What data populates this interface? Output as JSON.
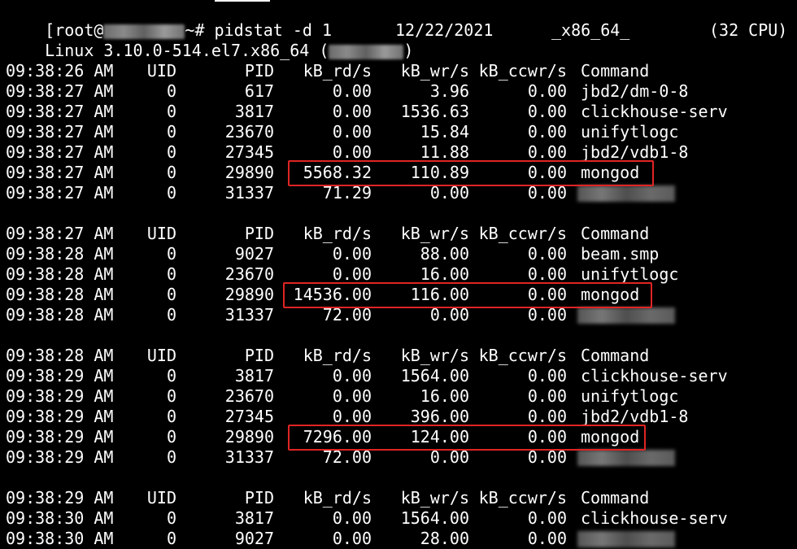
{
  "prompt": {
    "open": "[root@",
    "tail": "~# pidstat -d 1"
  },
  "sysline": {
    "kernel": "Linux 3.10.0-514.el7.x86_64 (",
    "host_close": ")",
    "date": "12/22/2021",
    "arch": "_x86_64_",
    "cpus": "(32 CPU)"
  },
  "columns": {
    "uid": "UID",
    "pid": "PID",
    "rd": "kB_rd/s",
    "wr": "kB_wr/s",
    "ccwr": "kB_ccwr/s",
    "cmd": "Command"
  },
  "blocks": [
    {
      "header_time": "09:38:26 AM",
      "rows": [
        {
          "time": "09:38:27 AM",
          "uid": "0",
          "pid": "617",
          "rd": "0.00",
          "wr": "3.96",
          "ccwr": "0.00",
          "cmd": "jbd2/dm-0-8"
        },
        {
          "time": "09:38:27 AM",
          "uid": "0",
          "pid": "3817",
          "rd": "0.00",
          "wr": "1536.63",
          "ccwr": "0.00",
          "cmd": "clickhouse-serv"
        },
        {
          "time": "09:38:27 AM",
          "uid": "0",
          "pid": "23670",
          "rd": "0.00",
          "wr": "15.84",
          "ccwr": "0.00",
          "cmd": "unifytlogc"
        },
        {
          "time": "09:38:27 AM",
          "uid": "0",
          "pid": "27345",
          "rd": "0.00",
          "wr": "11.88",
          "ccwr": "0.00",
          "cmd": "jbd2/vdb1-8"
        },
        {
          "time": "09:38:27 AM",
          "uid": "0",
          "pid": "29890",
          "rd": "5568.32",
          "wr": "110.89",
          "ccwr": "0.00",
          "cmd": "mongod"
        },
        {
          "time": "09:38:27 AM",
          "uid": "0",
          "pid": "31337",
          "rd": "71.29",
          "wr": "0.00",
          "ccwr": "0.00",
          "cmd": ""
        }
      ]
    },
    {
      "header_time": "09:38:27 AM",
      "rows": [
        {
          "time": "09:38:28 AM",
          "uid": "0",
          "pid": "9027",
          "rd": "0.00",
          "wr": "88.00",
          "ccwr": "0.00",
          "cmd": "beam.smp"
        },
        {
          "time": "09:38:28 AM",
          "uid": "0",
          "pid": "23670",
          "rd": "0.00",
          "wr": "16.00",
          "ccwr": "0.00",
          "cmd": "unifytlogc"
        },
        {
          "time": "09:38:28 AM",
          "uid": "0",
          "pid": "29890",
          "rd": "14536.00",
          "wr": "116.00",
          "ccwr": "0.00",
          "cmd": "mongod"
        },
        {
          "time": "09:38:28 AM",
          "uid": "0",
          "pid": "31337",
          "rd": "72.00",
          "wr": "0.00",
          "ccwr": "0.00",
          "cmd": ""
        }
      ]
    },
    {
      "header_time": "09:38:28 AM",
      "rows": [
        {
          "time": "09:38:29 AM",
          "uid": "0",
          "pid": "3817",
          "rd": "0.00",
          "wr": "1564.00",
          "ccwr": "0.00",
          "cmd": "clickhouse-serv"
        },
        {
          "time": "09:38:29 AM",
          "uid": "0",
          "pid": "23670",
          "rd": "0.00",
          "wr": "16.00",
          "ccwr": "0.00",
          "cmd": "unifytlogc"
        },
        {
          "time": "09:38:29 AM",
          "uid": "0",
          "pid": "27345",
          "rd": "0.00",
          "wr": "396.00",
          "ccwr": "0.00",
          "cmd": "jbd2/vdb1-8"
        },
        {
          "time": "09:38:29 AM",
          "uid": "0",
          "pid": "29890",
          "rd": "7296.00",
          "wr": "124.00",
          "ccwr": "0.00",
          "cmd": "mongod"
        },
        {
          "time": "09:38:29 AM",
          "uid": "0",
          "pid": "31337",
          "rd": "72.00",
          "wr": "0.00",
          "ccwr": "0.00",
          "cmd": ""
        }
      ]
    },
    {
      "header_time": "09:38:29 AM",
      "rows": [
        {
          "time": "09:38:30 AM",
          "uid": "0",
          "pid": "3817",
          "rd": "0.00",
          "wr": "1564.00",
          "ccwr": "0.00",
          "cmd": "clickhouse-serv"
        },
        {
          "time": "09:38:30 AM",
          "uid": "0",
          "pid": "9027",
          "rd": "0.00",
          "wr": "28.00",
          "ccwr": "0.00",
          "cmd": ""
        }
      ]
    }
  ],
  "colors": {
    "background": "#000000",
    "text": "#ffffff",
    "highlight": "#e02424"
  }
}
